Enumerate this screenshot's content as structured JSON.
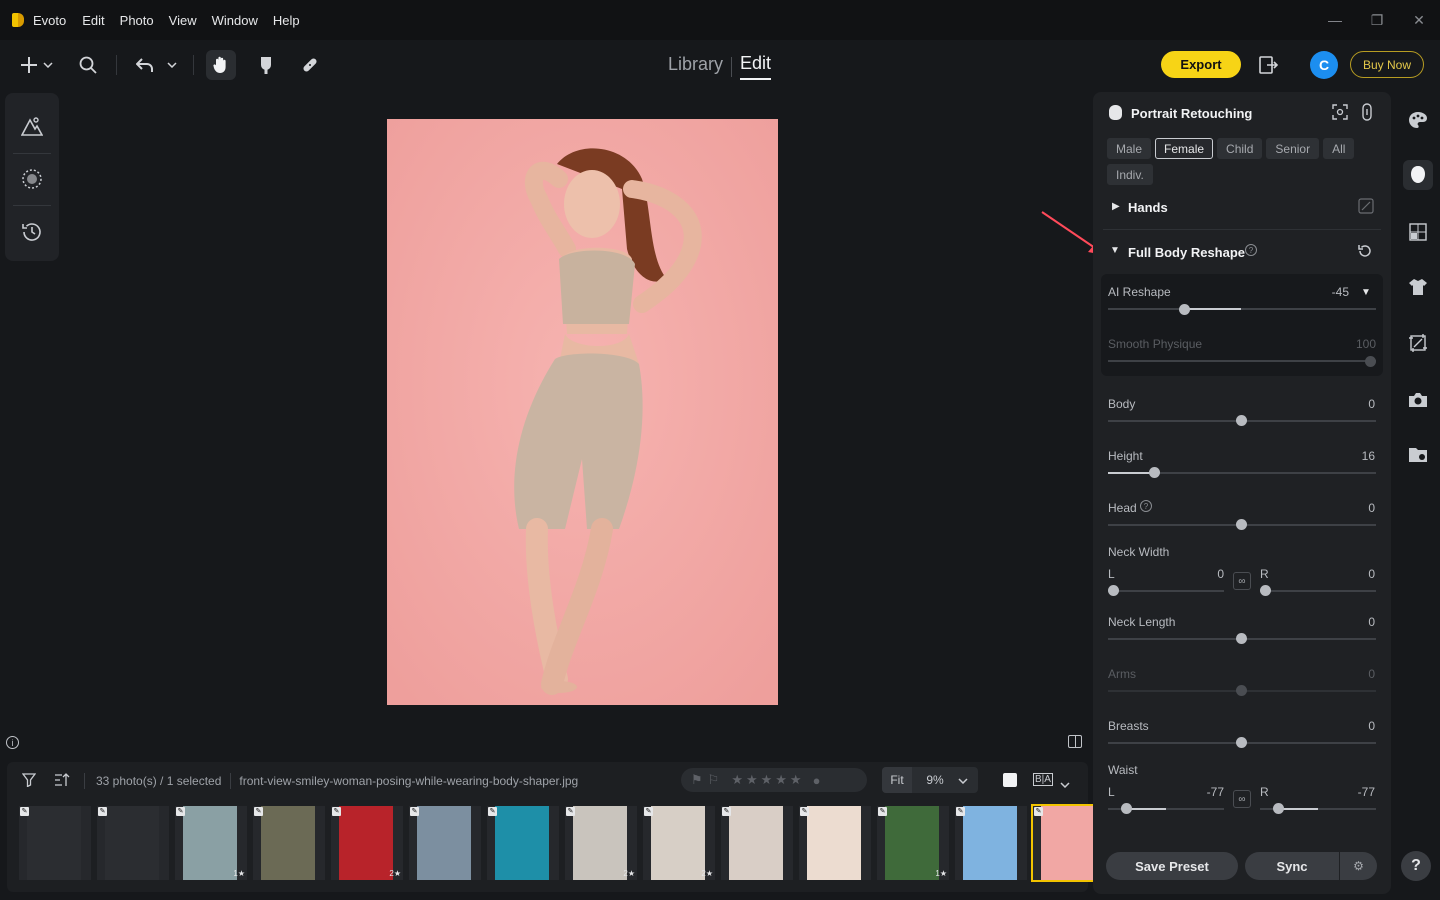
{
  "app": {
    "name": "Evoto"
  },
  "menu": [
    "Edit",
    "Photo",
    "View",
    "Window",
    "Help"
  ],
  "window_controls": {
    "minimize": "—",
    "restore": "❐",
    "close": "✕"
  },
  "modes": {
    "library": "Library",
    "edit": "Edit",
    "active": "Edit"
  },
  "toolbar": {
    "export_label": "Export",
    "buy_label": "Buy Now",
    "avatar_letter": "C"
  },
  "filmstrip": {
    "count_text": "33 photo(s) / 1 selected",
    "filename": "front-view-smiley-woman-posing-while-wearing-body-shaper.jpg",
    "zoom_fit": "Fit",
    "zoom_value": "9%",
    "compare_label": "B|A",
    "thumbs": [
      {
        "color": "#2b2d31",
        "badge": "",
        "star": ""
      },
      {
        "color": "#2b2d31",
        "badge": "",
        "star": ""
      },
      {
        "color": "#8aa0a4",
        "badge": "1",
        "star": "★"
      },
      {
        "color": "#6b6a55",
        "badge": "",
        "star": ""
      },
      {
        "color": "#b8232a",
        "badge": "2",
        "star": "★"
      },
      {
        "color": "#7c8fa0",
        "badge": "",
        "star": ""
      },
      {
        "color": "#1e8fa8",
        "badge": "",
        "star": ""
      },
      {
        "color": "#c9c4bd",
        "badge": "2",
        "star": "★"
      },
      {
        "color": "#d7cfc6",
        "badge": "2",
        "star": "★"
      },
      {
        "color": "#d9cec6",
        "badge": "",
        "star": ""
      },
      {
        "color": "#ecdcd0",
        "badge": "",
        "star": ""
      },
      {
        "color": "#3f6a3a",
        "badge": "1",
        "star": "★"
      },
      {
        "color": "#7fb3e0",
        "badge": "",
        "star": ""
      },
      {
        "color": "#f1a7a4",
        "badge": "",
        "star": ""
      }
    ]
  },
  "panel": {
    "title": "Portrait Retouching",
    "chips": [
      "Male",
      "Female",
      "Child",
      "Senior",
      "All",
      "Indiv."
    ],
    "active_chip": "Female",
    "hands_label": "Hands",
    "reshape_label": "Full Body Reshape",
    "ai_reshape": {
      "label": "AI Reshape",
      "value": "-45"
    },
    "smooth": {
      "label": "Smooth Physique",
      "value": "100"
    },
    "sliders": {
      "body": {
        "label": "Body",
        "value": "0"
      },
      "height": {
        "label": "Height",
        "value": "16"
      },
      "head": {
        "label": "Head",
        "value": "0"
      },
      "neck_width": {
        "label": "Neck Width",
        "l": "L",
        "l_value": "0",
        "r": "R",
        "r_value": "0"
      },
      "neck_length": {
        "label": "Neck Length",
        "value": "0"
      },
      "arms": {
        "label": "Arms",
        "value": "0"
      },
      "breasts": {
        "label": "Breasts",
        "value": "0"
      },
      "waist": {
        "label": "Waist",
        "l": "L",
        "l_value": "-77",
        "r": "R",
        "r_value": "-77"
      }
    },
    "save_preset": "Save Preset",
    "sync": "Sync"
  },
  "help": "?",
  "colors": {
    "accent": "#f7d416",
    "avatar": "#1c8ef0",
    "canvas_bg": "#f1a7a4",
    "arrow": "#ff4a5a"
  }
}
